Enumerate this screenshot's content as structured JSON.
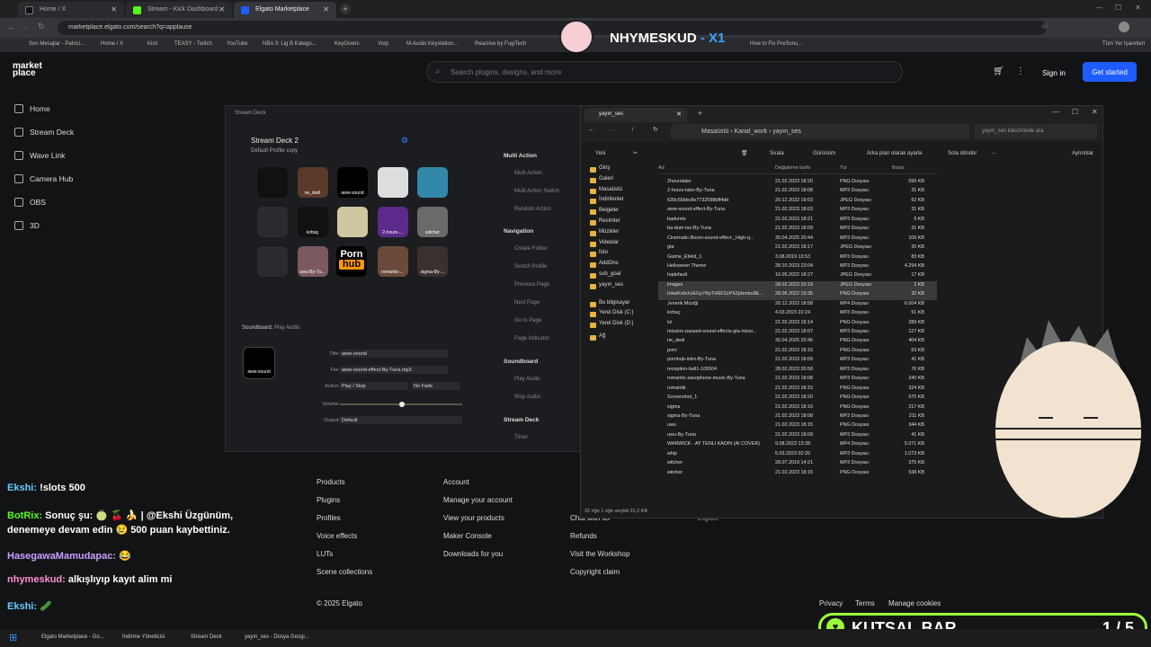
{
  "browser": {
    "tabs": [
      {
        "label": "Home / X"
      },
      {
        "label": "Stream - Kick Dashboard"
      },
      {
        "label": "Elgato Marketplace"
      }
    ],
    "url": "marketplace.elgato.com/search?q=applause",
    "bookmarks": [
      "Son Mesajlar - Patrici...",
      "Home / X",
      "Kick",
      "TEASY - Twitch",
      "YouTube",
      "NBA 3: Lig B Katego...",
      "KeyGivers",
      "Vorp",
      "M-Audio Keystation...",
      "Reactive by FugiTech",
      "How to Fix PreSonu...",
      "Tüm Yer İşaretleri"
    ]
  },
  "overlay": {
    "streamer_name": "NHYMESKUD",
    "streamer_tag": "- X1"
  },
  "marketplace": {
    "logo_line1": "market",
    "logo_line2": "place",
    "search_placeholder": "Search plugins, designs, and more",
    "sign_in": "Sign in",
    "get_started": "Get started",
    "nav": [
      "Home",
      "Stream Deck",
      "Wave Link",
      "Camera Hub",
      "OBS",
      "3D"
    ],
    "footer": {
      "col1": [
        "Products",
        "Plugins",
        "Profiles",
        "Voice effects",
        "LUTs",
        "Scene collections"
      ],
      "col2": [
        "Account",
        "Manage your account",
        "View your products",
        "Maker Console",
        "Downloads for you"
      ],
      "col3": [
        "Chat with us",
        "Refunds",
        "Visit the Workshop",
        "Copyright claim"
      ],
      "col4": "Elgato",
      "copyright": "© 2025 Elgato",
      "links": [
        "Privacy",
        "Terms",
        "Manage cookies"
      ]
    }
  },
  "streamdeck": {
    "title": "Stream Deck",
    "device": "Stream Deck 2",
    "profile": "Default Profile copy",
    "keys": [
      "",
      "ne_dedi",
      "aww-sound",
      "",
      "",
      "",
      "kırbaç",
      "",
      "2-hours-...",
      "witcher",
      "",
      "uwu-By-Tu...",
      "",
      "romantic-...",
      "sigma-By-..."
    ],
    "porn_label": "Porn",
    "hub_label": "hub",
    "soundboard_label": "Soundboard:",
    "soundboard_action": "Play Audio",
    "preview_label": "aww-sound",
    "fields": {
      "title_label": "Title:",
      "title_value": "aww-sound",
      "file_label": "File:",
      "file_value": "aww-sound-effect-By-Tuna.mp3",
      "action_label": "Action:",
      "action_value": "Play / Stop",
      "fade_value": "No Fade",
      "volume_label": "Volume:",
      "output_label": "Output:",
      "output_value": "Default"
    },
    "actions": {
      "multi_header": "Multi Action",
      "multi_items": [
        "Multi Action",
        "Multi Action Switch",
        "Random Action"
      ],
      "nav_header": "Navigation",
      "nav_items": [
        "Create Folder",
        "Switch Profile",
        "Previous Page",
        "Next Page",
        "Go to Page",
        "Page Indicator"
      ],
      "sound_header": "Soundboard",
      "sound_items": [
        "Play Audio",
        "Stop Audio"
      ],
      "sd_header": "Stream Deck",
      "sd_items": [
        "Timer"
      ]
    }
  },
  "explorer": {
    "tab": "yayın_ses",
    "path": [
      "Masaüstü",
      "Kanal_work",
      "yayın_ses"
    ],
    "search_placeholder": "yayın_ses klasöründe ara",
    "toolbar": [
      "Yeni",
      "Sırala",
      "Görünüm",
      "Arka plan olarak ayarla",
      "Sola döndür",
      "Ayrıntılar"
    ],
    "columns": [
      "Ad",
      "Değiştirme tarihi",
      "Tür",
      "Boyut"
    ],
    "nav": [
      "Giriş",
      "Galeri",
      "Masaüstü",
      "İndirilenler",
      "Belgeler",
      "Resimler",
      "Müzikler",
      "Videolar",
      "foto",
      "AddOns",
      "sub_goal",
      "yayın_ses",
      "Bu bilgisayar",
      "Yerel Disk (C:)",
      "Yerel Disk (D:)",
      "Ağ"
    ],
    "files": [
      [
        "2hourslater",
        "21.02.2023 18:20",
        "PNG Dosyası",
        "599 KB"
      ],
      [
        "2-hours-later-By-Tuna",
        "21.02.2023 18:08",
        "MP3 Dosyası",
        "31 KB"
      ],
      [
        "639c55bbc8e7732598bff4dd",
        "20.12.2022 19:03",
        "JPEG Dosyası",
        "62 KB"
      ],
      [
        "aww-sound-effect-By-Tuna",
        "21.02.2023 18:03",
        "MP3 Dosyası",
        "31 KB"
      ],
      [
        "badumts",
        "21.02.2023 18:21",
        "MP3 Dosyası",
        "5 KB"
      ],
      [
        "ba-dum-tss-By-Tuna",
        "21.02.2023 18:09",
        "MP3 Dosyası",
        "31 KB"
      ],
      [
        "Cinematic-Boom-sound-effect-_High-q...",
        "30.04.2025 20:44",
        "MP3 Dosyası",
        "109 KB"
      ],
      [
        "gta",
        "21.02.2023 18:17",
        "JPEG Dosyası",
        "20 KB"
      ],
      [
        "Gulme_Efekti_1",
        "3.08.2019 13:53",
        "MP3 Dosyası",
        "83 KB"
      ],
      [
        "Helloween Theme",
        "28.10.2023 23:04",
        "MP3 Dosyası",
        "4.294 KB"
      ],
      [
        "hqdefault",
        "16.05.2022 18:27",
        "JPEG Dosyası",
        "17 KB"
      ],
      [
        "images",
        "28.02.2023 20:19",
        "JPEG Dosyası",
        "2 KB"
      ],
      [
        "InkwKrdsXzEGyYKpTH6FZzPXZpbmbu9E...",
        "28.06.2022 19:35",
        "PNG Dosyası",
        "32 KB"
      ],
      [
        "Jenerik Müziği",
        "20.12.2022 18:58",
        "MP4 Dosyası",
        "6.004 KB"
      ],
      [
        "kırbaç",
        "4.03.2023 22:24",
        "MP3 Dosyası",
        "51 KB"
      ],
      [
        "lol",
        "21.02.2023 18:14",
        "PNG Dosyası",
        "289 KB"
      ],
      [
        "mission-passed-sound-effects-gta-missi...",
        "21.02.2023 18:07",
        "MP3 Dosyası",
        "127 KB"
      ],
      [
        "ne_dedi",
        "30.04.2025 20:45",
        "PNG Dosyası",
        "404 KB"
      ],
      [
        "porn",
        "21.02.2023 18:16",
        "PNG Dosyası",
        "63 KB"
      ],
      [
        "pornhub-intro-By-Tuna",
        "21.02.2023 18:09",
        "MP3 Dosyası",
        "41 KB"
      ],
      [
        "reception-bell1-105504",
        "28.02.2023 20:58",
        "MP3 Dosyası",
        "76 KB"
      ],
      [
        "romantic-saxophone-music-By-Tuna",
        "21.02.2023 18:08",
        "MP3 Dosyası",
        "240 KB"
      ],
      [
        "romantik",
        "21.02.2023 18:15",
        "PNG Dosyası",
        "324 KB"
      ],
      [
        "Screenshot_1",
        "21.02.2023 18:20",
        "PNG Dosyası",
        "575 KB"
      ],
      [
        "sigma",
        "21.02.2023 18:16",
        "PNG Dosyası",
        "217 KB"
      ],
      [
        "sigma-By-Tuna",
        "21.02.2023 18:08",
        "MP3 Dosyası",
        "211 KB"
      ],
      [
        "uwu",
        "21.02.2023 18:15",
        "PNG Dosyası",
        "344 KB"
      ],
      [
        "uwu-By-Tuna",
        "21.02.2023 18:09",
        "MP3 Dosyası",
        "41 KB"
      ],
      [
        "WARWICK - AY TENLİ KADIN (AI COVER)",
        "9.08.2023 13:28",
        "MP4 Dosyası",
        "5.071 KB"
      ],
      [
        "whip",
        "5.03.2023 02:20",
        "MP3 Dosyası",
        "1.073 KB"
      ],
      [
        "witcher",
        "28.07.2019 14:21",
        "MP3 Dosyası",
        "375 KB"
      ],
      [
        "witcher",
        "21.02.2023 18:15",
        "PNG Dosyası",
        "538 KB"
      ]
    ],
    "status": "32 öğe   1 öğe seçildi  31,2 KB"
  },
  "chat": [
    {
      "user": "Ekshi:",
      "msg": "!slots 500"
    },
    {
      "user": "BotRix:",
      "msg": "Sonuç şu: 🍈 🍒 🍌 | @Ekshi Üzgünüm, denemeye devam edin 😢 500 puan kaybettiniz."
    },
    {
      "user": "HasegawaMamudapac:",
      "msg": "😂"
    },
    {
      "user": "nhymeskud:",
      "msg": "alkışlıyıp kayıt alim mi"
    },
    {
      "user": "Ekshi:",
      "msg": "🥒"
    }
  ],
  "kutsal_bar": {
    "label": "KUTSAL BAR",
    "count": "1 / 5"
  },
  "taskbar": [
    "Elgato Marketplace - Go...",
    "İndirme Yöneticisi",
    "Stream Deck",
    "yayın_ses - Dosya Gezgi..."
  ]
}
